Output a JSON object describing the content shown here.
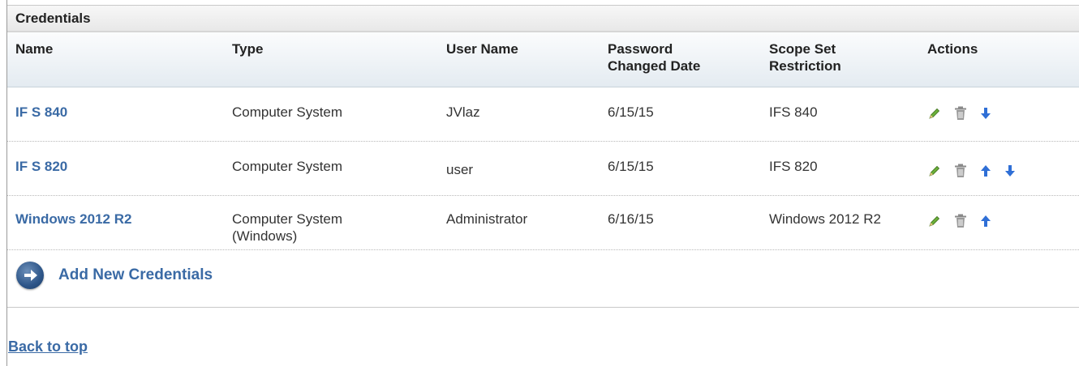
{
  "panel": {
    "title": "Credentials"
  },
  "columns": {
    "name": "Name",
    "type": "Type",
    "user_name": "User Name",
    "password_changed_1": "Password",
    "password_changed_2": "Changed Date",
    "scope_1": "Scope Set",
    "scope_2": "Restriction",
    "actions": "Actions"
  },
  "rows": [
    {
      "name": "IF S 840",
      "type_1": "Computer System",
      "type_2": "",
      "user": "JVlaz",
      "date": "6/15/15",
      "scope": "IFS 840",
      "actions": [
        "edit-icon",
        "delete-icon",
        "move-down-icon"
      ]
    },
    {
      "name": "IF S 820",
      "type_1": "Computer System",
      "type_2": "",
      "user": "user",
      "date": "6/15/15",
      "scope": "IFS 820",
      "actions": [
        "edit-icon",
        "delete-icon",
        "move-up-icon",
        "move-down-icon"
      ]
    },
    {
      "name": "Windows 2012 R2",
      "type_1": "Computer System",
      "type_2": "(Windows)",
      "user": "Administrator",
      "date": "6/16/15",
      "scope": "Windows 2012 R2",
      "actions": [
        "edit-icon",
        "delete-icon",
        "move-up-icon"
      ]
    }
  ],
  "add": {
    "label": "Add New Credentials",
    "icon": "arrow-right-circle-icon"
  },
  "back_to_top": "Back to top",
  "colors": {
    "link": "#3a6aa5",
    "edit": "#4a8a1f",
    "arrow": "#2f6fd6",
    "trash": "#8a8a8a"
  }
}
